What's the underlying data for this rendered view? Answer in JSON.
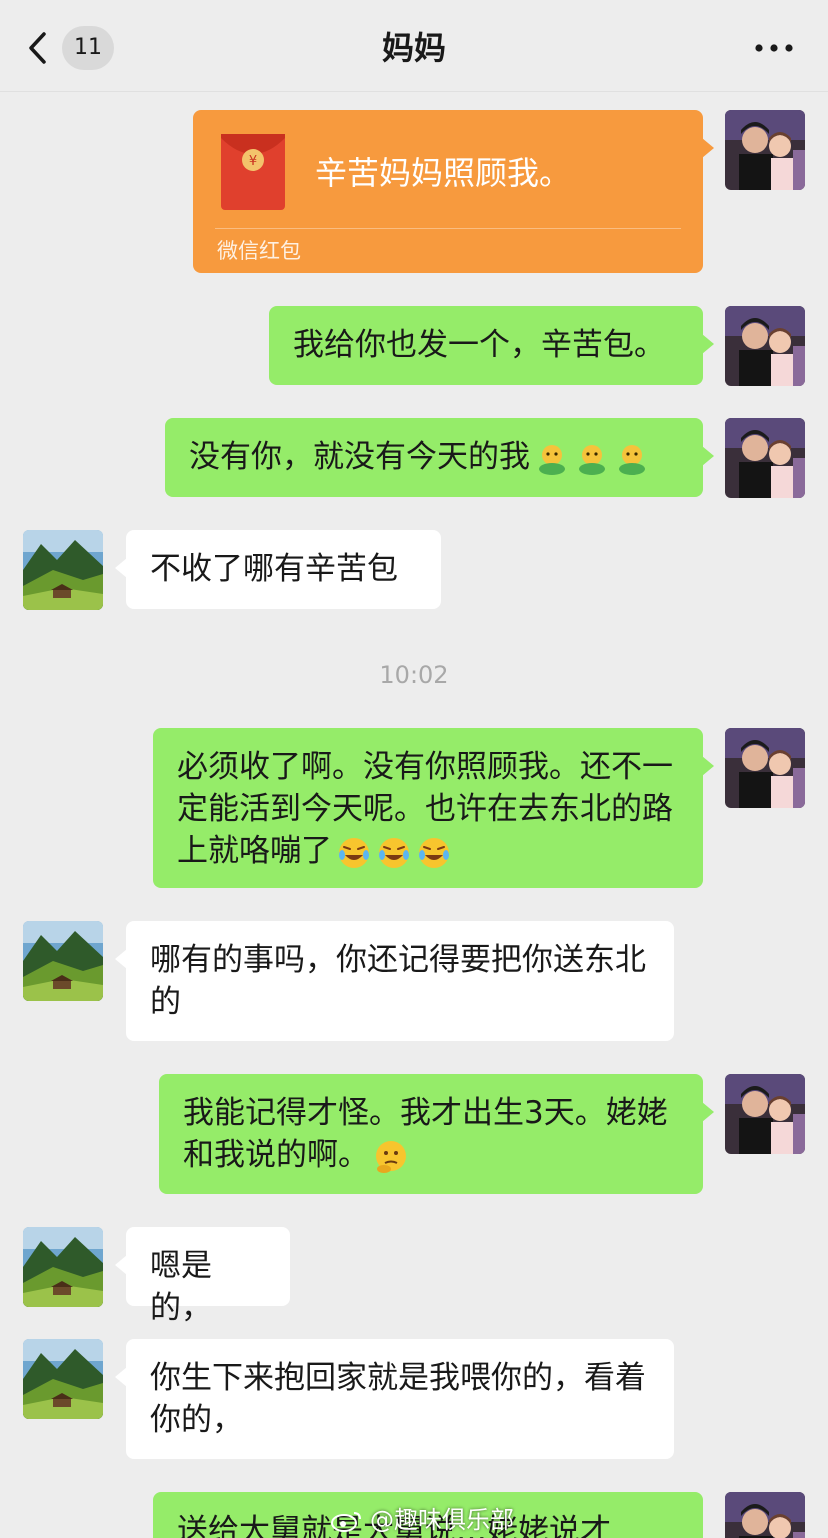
{
  "header": {
    "title": "妈妈",
    "unread_count": "11",
    "back_icon": "chevron-left-icon",
    "more_icon": "ellipsis-icon"
  },
  "red_packet": {
    "message": "辛苦妈妈照顾我。",
    "label": "微信红包",
    "icon": "red-envelope-icon"
  },
  "messages": [
    {
      "from": "me",
      "text": "我给你也发一个，辛苦包。"
    },
    {
      "from": "me",
      "text": "没有你，就没有今天的我",
      "emoji": "hug-emoji x3"
    },
    {
      "from": "mom",
      "text": "不收了哪有辛苦包"
    },
    {
      "from": "me",
      "text": "必须收了啊。没有你照顾我。还不一定能活到今天呢。也许在去东北的路上就咯嘣了",
      "emoji": "laughing-tears-emoji x3"
    },
    {
      "from": "mom",
      "text": "哪有的事吗，你还记得要把你送东北的"
    },
    {
      "from": "me",
      "text": "我能记得才怪。我才出生3天。姥姥和我说的啊。",
      "emoji": "thinking-face-emoji"
    },
    {
      "from": "mom",
      "text": "嗯是的，"
    },
    {
      "from": "mom",
      "text": "你生下来抱回家就是我喂你的，看着你的，"
    },
    {
      "from": "me",
      "text": "送给大舅就是大舅说…姥姥说才"
    }
  ],
  "timestamp": "10:02",
  "watermark": "@趣味俱乐部",
  "colors": {
    "background": "#ededed",
    "sent_bubble": "#95ec69",
    "recv_bubble": "#ffffff",
    "red_packet": "#f79a3e"
  }
}
